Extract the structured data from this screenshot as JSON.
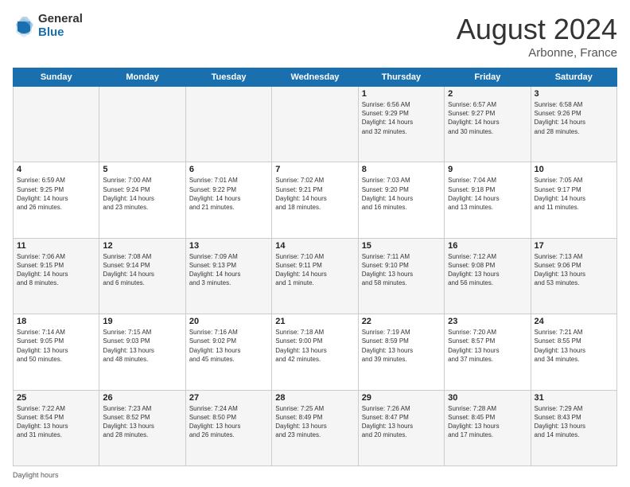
{
  "header": {
    "logo_general": "General",
    "logo_blue": "Blue",
    "month_title": "August 2024",
    "location": "Arbonne, France"
  },
  "days_of_week": [
    "Sunday",
    "Monday",
    "Tuesday",
    "Wednesday",
    "Thursday",
    "Friday",
    "Saturday"
  ],
  "footer": {
    "label": "Daylight hours"
  },
  "weeks": [
    [
      {
        "day": "",
        "info": ""
      },
      {
        "day": "",
        "info": ""
      },
      {
        "day": "",
        "info": ""
      },
      {
        "day": "",
        "info": ""
      },
      {
        "day": "1",
        "info": "Sunrise: 6:56 AM\nSunset: 9:29 PM\nDaylight: 14 hours\nand 32 minutes."
      },
      {
        "day": "2",
        "info": "Sunrise: 6:57 AM\nSunset: 9:27 PM\nDaylight: 14 hours\nand 30 minutes."
      },
      {
        "day": "3",
        "info": "Sunrise: 6:58 AM\nSunset: 9:26 PM\nDaylight: 14 hours\nand 28 minutes."
      }
    ],
    [
      {
        "day": "4",
        "info": "Sunrise: 6:59 AM\nSunset: 9:25 PM\nDaylight: 14 hours\nand 26 minutes."
      },
      {
        "day": "5",
        "info": "Sunrise: 7:00 AM\nSunset: 9:24 PM\nDaylight: 14 hours\nand 23 minutes."
      },
      {
        "day": "6",
        "info": "Sunrise: 7:01 AM\nSunset: 9:22 PM\nDaylight: 14 hours\nand 21 minutes."
      },
      {
        "day": "7",
        "info": "Sunrise: 7:02 AM\nSunset: 9:21 PM\nDaylight: 14 hours\nand 18 minutes."
      },
      {
        "day": "8",
        "info": "Sunrise: 7:03 AM\nSunset: 9:20 PM\nDaylight: 14 hours\nand 16 minutes."
      },
      {
        "day": "9",
        "info": "Sunrise: 7:04 AM\nSunset: 9:18 PM\nDaylight: 14 hours\nand 13 minutes."
      },
      {
        "day": "10",
        "info": "Sunrise: 7:05 AM\nSunset: 9:17 PM\nDaylight: 14 hours\nand 11 minutes."
      }
    ],
    [
      {
        "day": "11",
        "info": "Sunrise: 7:06 AM\nSunset: 9:15 PM\nDaylight: 14 hours\nand 8 minutes."
      },
      {
        "day": "12",
        "info": "Sunrise: 7:08 AM\nSunset: 9:14 PM\nDaylight: 14 hours\nand 6 minutes."
      },
      {
        "day": "13",
        "info": "Sunrise: 7:09 AM\nSunset: 9:13 PM\nDaylight: 14 hours\nand 3 minutes."
      },
      {
        "day": "14",
        "info": "Sunrise: 7:10 AM\nSunset: 9:11 PM\nDaylight: 14 hours\nand 1 minute."
      },
      {
        "day": "15",
        "info": "Sunrise: 7:11 AM\nSunset: 9:10 PM\nDaylight: 13 hours\nand 58 minutes."
      },
      {
        "day": "16",
        "info": "Sunrise: 7:12 AM\nSunset: 9:08 PM\nDaylight: 13 hours\nand 56 minutes."
      },
      {
        "day": "17",
        "info": "Sunrise: 7:13 AM\nSunset: 9:06 PM\nDaylight: 13 hours\nand 53 minutes."
      }
    ],
    [
      {
        "day": "18",
        "info": "Sunrise: 7:14 AM\nSunset: 9:05 PM\nDaylight: 13 hours\nand 50 minutes."
      },
      {
        "day": "19",
        "info": "Sunrise: 7:15 AM\nSunset: 9:03 PM\nDaylight: 13 hours\nand 48 minutes."
      },
      {
        "day": "20",
        "info": "Sunrise: 7:16 AM\nSunset: 9:02 PM\nDaylight: 13 hours\nand 45 minutes."
      },
      {
        "day": "21",
        "info": "Sunrise: 7:18 AM\nSunset: 9:00 PM\nDaylight: 13 hours\nand 42 minutes."
      },
      {
        "day": "22",
        "info": "Sunrise: 7:19 AM\nSunset: 8:59 PM\nDaylight: 13 hours\nand 39 minutes."
      },
      {
        "day": "23",
        "info": "Sunrise: 7:20 AM\nSunset: 8:57 PM\nDaylight: 13 hours\nand 37 minutes."
      },
      {
        "day": "24",
        "info": "Sunrise: 7:21 AM\nSunset: 8:55 PM\nDaylight: 13 hours\nand 34 minutes."
      }
    ],
    [
      {
        "day": "25",
        "info": "Sunrise: 7:22 AM\nSunset: 8:54 PM\nDaylight: 13 hours\nand 31 minutes."
      },
      {
        "day": "26",
        "info": "Sunrise: 7:23 AM\nSunset: 8:52 PM\nDaylight: 13 hours\nand 28 minutes."
      },
      {
        "day": "27",
        "info": "Sunrise: 7:24 AM\nSunset: 8:50 PM\nDaylight: 13 hours\nand 26 minutes."
      },
      {
        "day": "28",
        "info": "Sunrise: 7:25 AM\nSunset: 8:49 PM\nDaylight: 13 hours\nand 23 minutes."
      },
      {
        "day": "29",
        "info": "Sunrise: 7:26 AM\nSunset: 8:47 PM\nDaylight: 13 hours\nand 20 minutes."
      },
      {
        "day": "30",
        "info": "Sunrise: 7:28 AM\nSunset: 8:45 PM\nDaylight: 13 hours\nand 17 minutes."
      },
      {
        "day": "31",
        "info": "Sunrise: 7:29 AM\nSunset: 8:43 PM\nDaylight: 13 hours\nand 14 minutes."
      }
    ]
  ]
}
